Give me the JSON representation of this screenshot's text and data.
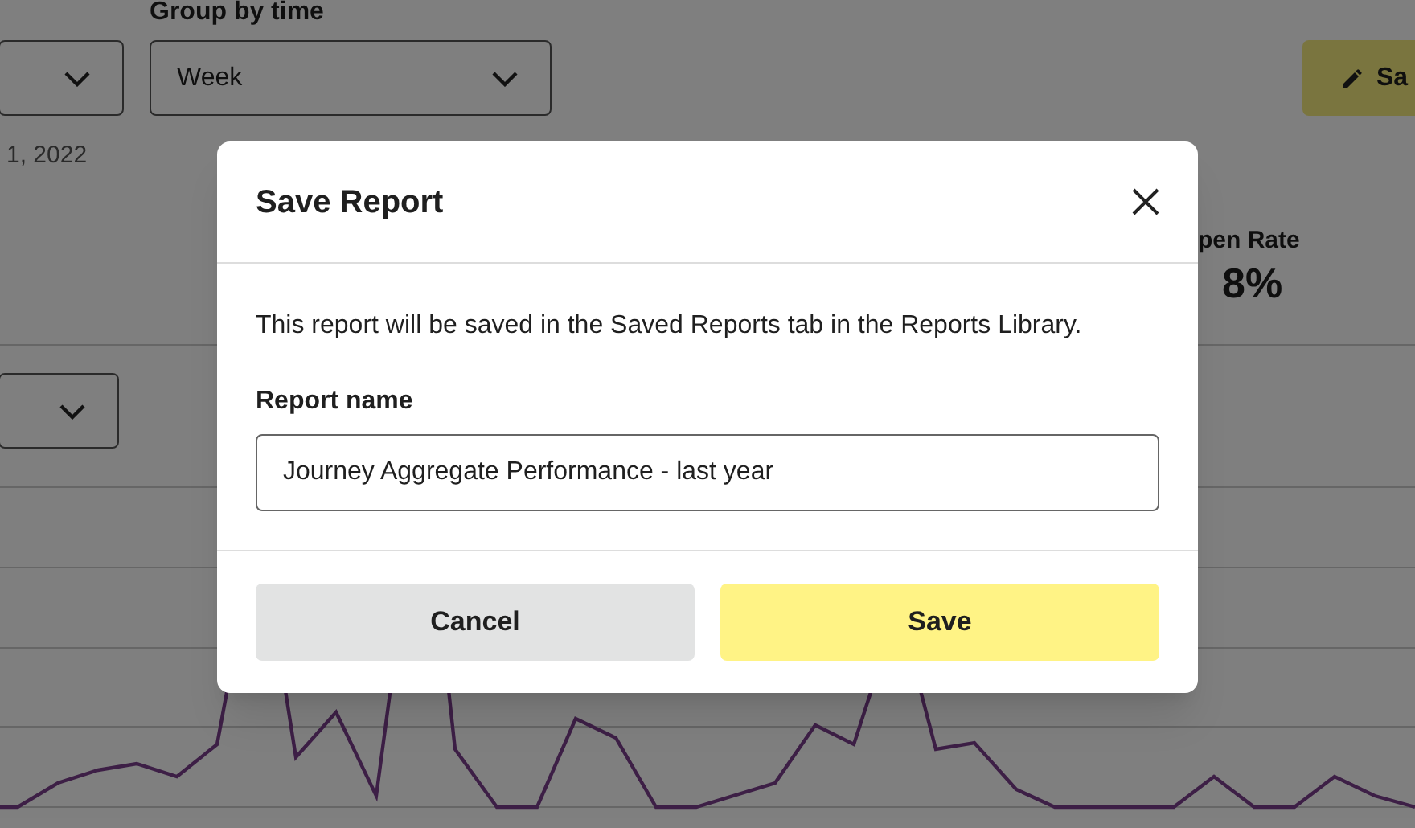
{
  "background": {
    "filter_dropdown": {
      "kind": "dropdown"
    },
    "group_by": {
      "label": "Group by time",
      "value": "Week"
    },
    "save_button": {
      "label": "Sa"
    },
    "date_range": "1, 2022",
    "metric": {
      "label": "pen Rate",
      "value": "8%"
    },
    "second_dropdown": {
      "kind": "dropdown"
    }
  },
  "dialog": {
    "title": "Save Report",
    "message": "This report will be saved in the Saved Reports tab in the Reports Library.",
    "field": {
      "label": "Report name",
      "value": "Journey Aggregate Performance - last year"
    },
    "buttons": [
      {
        "label": "Cancel",
        "kind": "secondary"
      },
      {
        "label": "Save",
        "kind": "primary"
      }
    ]
  }
}
